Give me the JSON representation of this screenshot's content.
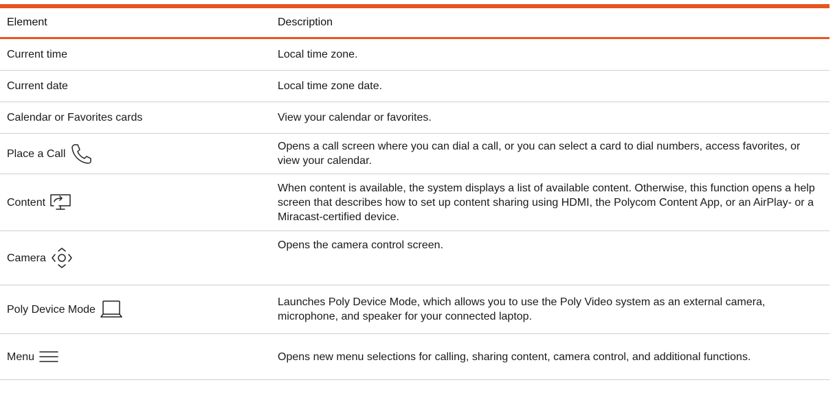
{
  "table": {
    "headers": {
      "element": "Element",
      "description": "Description"
    },
    "rows": [
      {
        "element": "Current time",
        "description": "Local time zone.",
        "icon": ""
      },
      {
        "element": "Current date",
        "description": "Local time zone date.",
        "icon": ""
      },
      {
        "element": "Calendar or Favorites cards",
        "description": "View your calendar or favorites.",
        "icon": ""
      },
      {
        "element": "Place a Call",
        "description": "Opens a call screen where you can dial a call, or you can select a card to dial numbers, access favorites, or view your calendar.",
        "icon": "phone-icon"
      },
      {
        "element": "Content",
        "description": "When content is available, the system displays a list of available content. Otherwise, this function opens a help screen that describes how to set up content sharing using HDMI, the Polycom Content App, or an AirPlay- or a Miracast-certified device.",
        "icon": "content-share-icon"
      },
      {
        "element": "Camera",
        "description": "Opens the camera control screen.",
        "icon": "camera-control-icon"
      },
      {
        "element": "Poly Device Mode",
        "description": "Launches Poly Device Mode, which allows you to use the Poly Video system as an external camera, microphone, and speaker for your connected laptop.",
        "icon": "laptop-icon"
      },
      {
        "element": "Menu",
        "description": "Opens new menu selections for calling, sharing content, camera control, and additional functions.",
        "icon": "menu-icon"
      }
    ]
  },
  "colors": {
    "accent": "#e8541f",
    "rule": "#cfcfcf",
    "text": "#1a1a1a"
  }
}
